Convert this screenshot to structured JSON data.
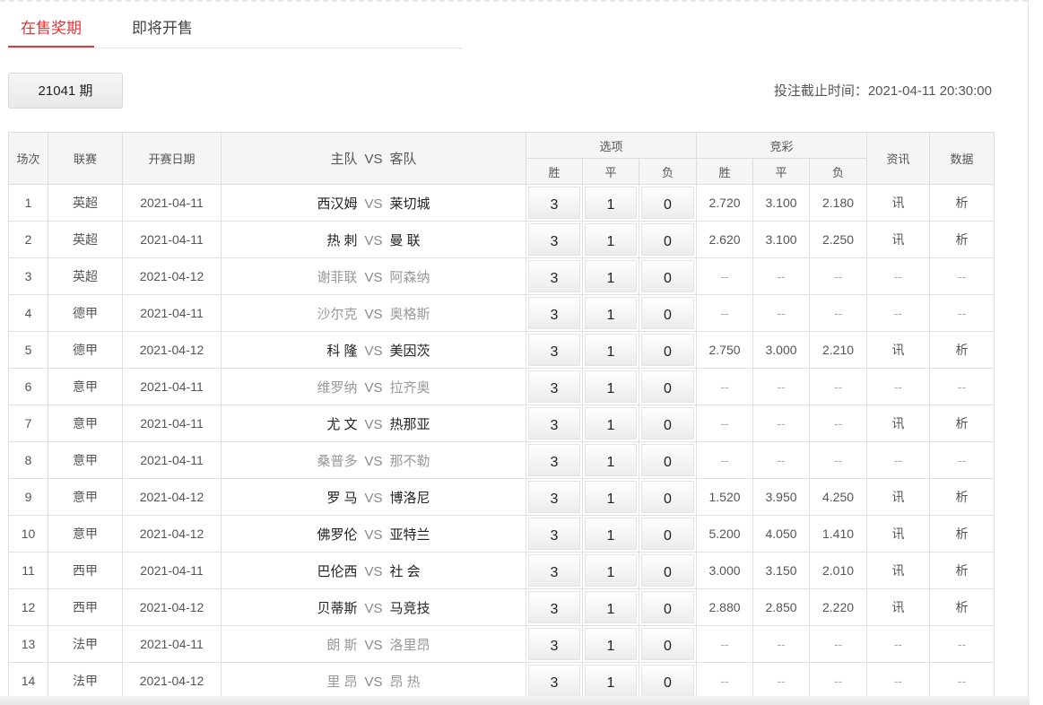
{
  "tabs": {
    "active": "在售奖期",
    "upcoming": "即将开售"
  },
  "period_label": "21041 期",
  "deadline": "投注截止时间：2021-04-11 20:30:00",
  "headers": {
    "round": "场次",
    "league": "联赛",
    "date": "开赛日期",
    "home": "主队",
    "vs": "VS",
    "away": "客队",
    "options": "选项",
    "jingcai": "竞彩",
    "win": "胜",
    "draw": "平",
    "lose": "负",
    "news": "资讯",
    "data": "数据"
  },
  "option_values": [
    "3",
    "1",
    "0"
  ],
  "rows": [
    {
      "no": "1",
      "league": "英超",
      "date": "2021-04-11",
      "home": "西汉姆",
      "away": "莱切城",
      "dim": false,
      "o1": "2.720",
      "o2": "3.100",
      "o3": "2.180",
      "news": "讯",
      "data": "析"
    },
    {
      "no": "2",
      "league": "英超",
      "date": "2021-04-11",
      "home": "热 刺",
      "away": "曼 联",
      "dim": false,
      "o1": "2.620",
      "o2": "3.100",
      "o3": "2.250",
      "news": "讯",
      "data": "析"
    },
    {
      "no": "3",
      "league": "英超",
      "date": "2021-04-12",
      "home": "谢菲联",
      "away": "阿森纳",
      "dim": true,
      "o1": "--",
      "o2": "--",
      "o3": "--",
      "news": "--",
      "data": "--"
    },
    {
      "no": "4",
      "league": "德甲",
      "date": "2021-04-11",
      "home": "沙尔克",
      "away": "奥格斯",
      "dim": true,
      "o1": "--",
      "o2": "--",
      "o3": "--",
      "news": "--",
      "data": "--"
    },
    {
      "no": "5",
      "league": "德甲",
      "date": "2021-04-12",
      "home": "科 隆",
      "away": "美因茨",
      "dim": false,
      "o1": "2.750",
      "o2": "3.000",
      "o3": "2.210",
      "news": "讯",
      "data": "析"
    },
    {
      "no": "6",
      "league": "意甲",
      "date": "2021-04-11",
      "home": "维罗纳",
      "away": "拉齐奥",
      "dim": true,
      "o1": "--",
      "o2": "--",
      "o3": "--",
      "news": "--",
      "data": "--"
    },
    {
      "no": "7",
      "league": "意甲",
      "date": "2021-04-11",
      "home": "尤 文",
      "away": "热那亚",
      "dim": false,
      "o1": "--",
      "o2": "--",
      "o3": "--",
      "news": "讯",
      "data": "析"
    },
    {
      "no": "8",
      "league": "意甲",
      "date": "2021-04-11",
      "home": "桑普多",
      "away": "那不勒",
      "dim": true,
      "o1": "--",
      "o2": "--",
      "o3": "--",
      "news": "--",
      "data": "--"
    },
    {
      "no": "9",
      "league": "意甲",
      "date": "2021-04-12",
      "home": "罗 马",
      "away": "博洛尼",
      "dim": false,
      "o1": "1.520",
      "o2": "3.950",
      "o3": "4.250",
      "news": "讯",
      "data": "析"
    },
    {
      "no": "10",
      "league": "意甲",
      "date": "2021-04-12",
      "home": "佛罗伦",
      "away": "亚特兰",
      "dim": false,
      "o1": "5.200",
      "o2": "4.050",
      "o3": "1.410",
      "news": "讯",
      "data": "析"
    },
    {
      "no": "11",
      "league": "西甲",
      "date": "2021-04-11",
      "home": "巴伦西",
      "away": "社 会",
      "dim": false,
      "o1": "3.000",
      "o2": "3.150",
      "o3": "2.010",
      "news": "讯",
      "data": "析"
    },
    {
      "no": "12",
      "league": "西甲",
      "date": "2021-04-12",
      "home": "贝蒂斯",
      "away": "马竞技",
      "dim": false,
      "o1": "2.880",
      "o2": "2.850",
      "o3": "2.220",
      "news": "讯",
      "data": "析"
    },
    {
      "no": "13",
      "league": "法甲",
      "date": "2021-04-11",
      "home": "朗 斯",
      "away": "洛里昂",
      "dim": true,
      "o1": "--",
      "o2": "--",
      "o3": "--",
      "news": "--",
      "data": "--"
    },
    {
      "no": "14",
      "league": "法甲",
      "date": "2021-04-12",
      "home": "里 昂",
      "away": "昂 热",
      "dim": true,
      "o1": "--",
      "o2": "--",
      "o3": "--",
      "news": "--",
      "data": "--"
    }
  ]
}
